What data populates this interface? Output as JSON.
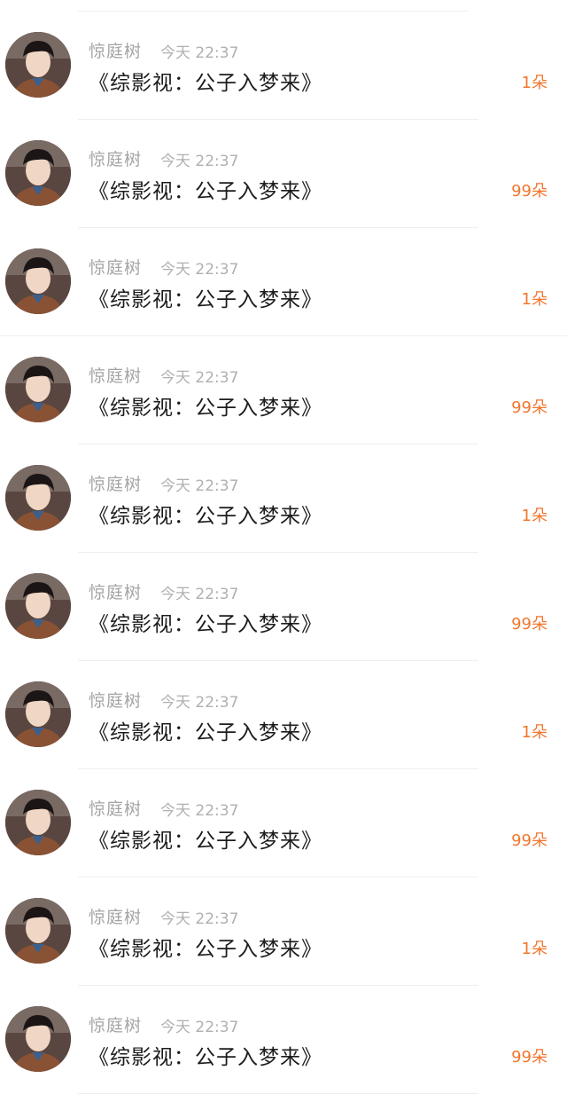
{
  "accent_color": "#f2762e",
  "rows": [
    {
      "user": "惊庭树",
      "time": "今天 22:37",
      "title": "《综影视：公子入梦来》",
      "gift": "1朵"
    },
    {
      "user": "惊庭树",
      "time": "今天 22:37",
      "title": "《综影视：公子入梦来》",
      "gift": "99朵"
    },
    {
      "user": "惊庭树",
      "time": "今天 22:37",
      "title": "《综影视：公子入梦来》",
      "gift": "1朵"
    },
    {
      "user": "惊庭树",
      "time": "今天 22:37",
      "title": "《综影视：公子入梦来》",
      "gift": "99朵"
    },
    {
      "user": "惊庭树",
      "time": "今天 22:37",
      "title": "《综影视：公子入梦来》",
      "gift": "1朵"
    },
    {
      "user": "惊庭树",
      "time": "今天 22:37",
      "title": "《综影视：公子入梦来》",
      "gift": "99朵"
    },
    {
      "user": "惊庭树",
      "time": "今天 22:37",
      "title": "《综影视：公子入梦来》",
      "gift": "1朵"
    },
    {
      "user": "惊庭树",
      "time": "今天 22:37",
      "title": "《综影视：公子入梦来》",
      "gift": "99朵"
    },
    {
      "user": "惊庭树",
      "time": "今天 22:37",
      "title": "《综影视：公子入梦来》",
      "gift": "1朵"
    },
    {
      "user": "惊庭树",
      "time": "今天 22:37",
      "title": "《综影视：公子入梦来》",
      "gift": "99朵"
    }
  ]
}
